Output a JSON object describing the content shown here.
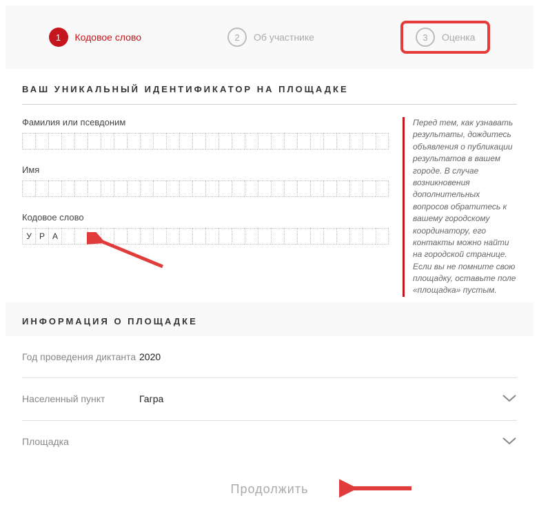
{
  "steps": [
    {
      "num": "1",
      "label": "Кодовое слово"
    },
    {
      "num": "2",
      "label": "Об участнике"
    },
    {
      "num": "3",
      "label": "Оценка"
    }
  ],
  "section_id_title": "ВАШ УНИКАЛЬНЫЙ ИДЕНТИФИКАТОР НА ПЛОЩАДКЕ",
  "fields": {
    "surname_label": "Фамилия или псевдоним",
    "name_label": "Имя",
    "codeword_label": "Кодовое слово",
    "codeword_value": [
      "У",
      "Р",
      "А"
    ]
  },
  "hint_text": "Перед тем, как узнавать результаты, дождитесь объявления о публикации результатов в вашем городе. В случае возникновения дополнительных вопросов обратитесь к вашему городскому координатору, его контакты можно найти на городской странице. Если вы не помните свою площадку, оставьте поле «площадка» пустым.",
  "section_info_title": "ИНФОРМАЦИЯ О ПЛОЩАДКЕ",
  "info": {
    "year_label": "Год проведения диктанта",
    "year_value": "2020",
    "city_label": "Населенный пункт",
    "city_value": "Гагра",
    "venue_label": "Площадка",
    "venue_value": ""
  },
  "submit_label": "Продолжить"
}
